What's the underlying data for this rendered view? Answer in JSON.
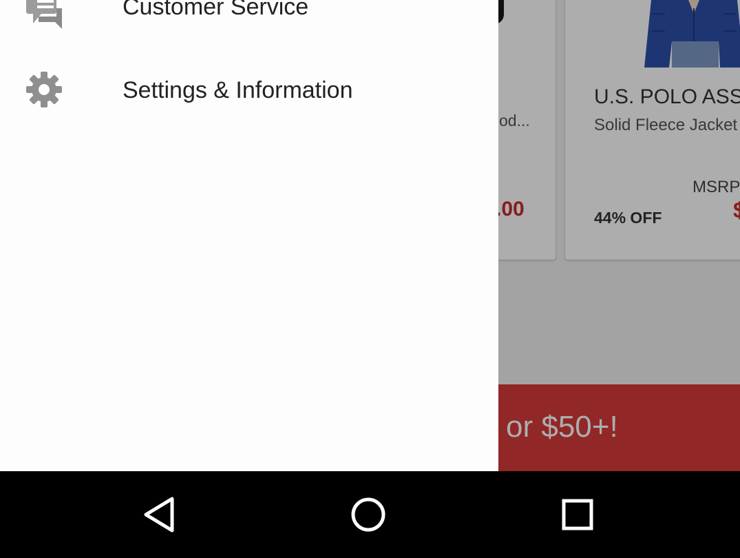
{
  "drawer": {
    "items": [
      {
        "label": "Customer Service",
        "icon": "chat-icon"
      },
      {
        "label": "Settings & Information",
        "icon": "gear-icon"
      }
    ]
  },
  "background": {
    "left_card": {
      "title_partial": "od...",
      "price_partial": ".00"
    },
    "right_card": {
      "brand": "U.S. POLO ASS",
      "product": "Solid Fleece Jacket",
      "msrp_label": "MSRP",
      "discount": "44% OFF",
      "price_partial": "$"
    },
    "promo": {
      "text": "or $50+!"
    }
  },
  "colors": {
    "accent_red": "#c62b2b",
    "banner_red": "#d63a3a",
    "drawer_bg": "#fdfdfd"
  },
  "nav_bar": {
    "buttons": [
      "back-icon",
      "home-icon",
      "recents-icon"
    ]
  }
}
